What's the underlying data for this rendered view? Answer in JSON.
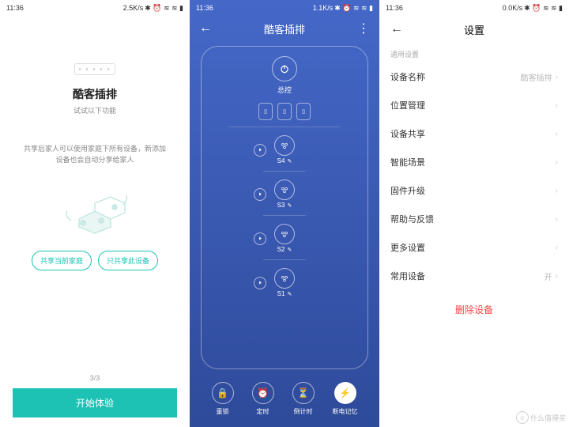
{
  "status": {
    "time": "11:36",
    "rates": [
      "2.5K/s",
      "1.1K/s",
      "0.0K/s"
    ],
    "icons": "✶ ⊙ ⏰ 📶 📶 🔋69"
  },
  "screen1": {
    "title": "酷客插排",
    "subtitle": "试试以下功能",
    "desc": "共享后家人可以使用家庭下所有设备，新添加设备也会自动分享给家人",
    "btn1": "共享当前家庭",
    "btn2": "只共享此设备",
    "pager": "3/3",
    "start": "开始体验"
  },
  "screen2": {
    "title": "酷客插排",
    "master": "总控",
    "sockets": [
      "S4",
      "S3",
      "S2",
      "S1"
    ],
    "bottom": [
      {
        "label": "童锁",
        "active": false
      },
      {
        "label": "定时",
        "active": false
      },
      {
        "label": "倒计时",
        "active": false
      },
      {
        "label": "断电记忆",
        "active": true
      }
    ]
  },
  "screen3": {
    "title": "设置",
    "section": "通用设置",
    "rows": [
      {
        "label": "设备名称",
        "value": "酷客插排"
      },
      {
        "label": "位置管理",
        "value": ""
      },
      {
        "label": "设备共享",
        "value": ""
      },
      {
        "label": "智能场景",
        "value": ""
      },
      {
        "label": "固件升级",
        "value": ""
      },
      {
        "label": "帮助与反馈",
        "value": ""
      },
      {
        "label": "更多设置",
        "value": ""
      },
      {
        "label": "常用设备",
        "value": "开"
      }
    ],
    "delete": "删除设备"
  },
  "watermark": "什么值得买"
}
